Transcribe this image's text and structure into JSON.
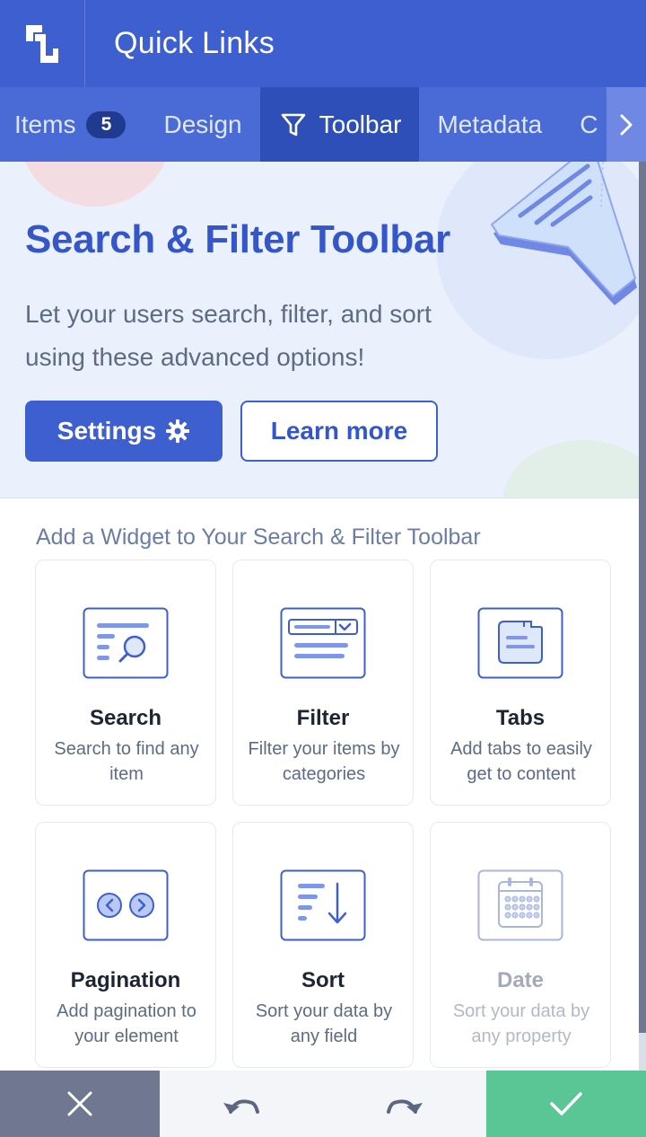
{
  "app": {
    "title": "Quick Links"
  },
  "tabs": [
    {
      "label": "Items",
      "badge": "5"
    },
    {
      "label": "Design"
    },
    {
      "label": "Toolbar"
    },
    {
      "label": "Metadata"
    },
    {
      "label": "C"
    }
  ],
  "hero": {
    "title": "Search & Filter Toolbar",
    "description": "Let your users search, filter, and sort using these advanced options!",
    "settings_label": "Settings",
    "learn_more_label": "Learn more"
  },
  "widgets": {
    "section_title": "Add a Widget to Your Search & Filter Toolbar",
    "items": [
      {
        "title": "Search",
        "description": "Search to find any item",
        "icon": "search-icon"
      },
      {
        "title": "Filter",
        "description": "Filter your items by categories",
        "icon": "filter-icon"
      },
      {
        "title": "Tabs",
        "description": "Add tabs to easily get to content",
        "icon": "tabs-icon"
      },
      {
        "title": "Pagination",
        "description": "Add pagination to your element",
        "icon": "pagination-icon"
      },
      {
        "title": "Sort",
        "description": "Sort your data by any field",
        "icon": "sort-icon"
      },
      {
        "title": "Date",
        "description": "Sort your data by any property",
        "icon": "calendar-icon",
        "disabled": true
      }
    ]
  },
  "colors": {
    "header": "#3e5fd0",
    "tab_bar": "#4a6bd6",
    "tab_active": "#2f4fb8",
    "hero_bg": "#eaf0fc",
    "hero_title": "#3556c9",
    "confirm": "#5ac595",
    "cancel": "#6f7890"
  }
}
